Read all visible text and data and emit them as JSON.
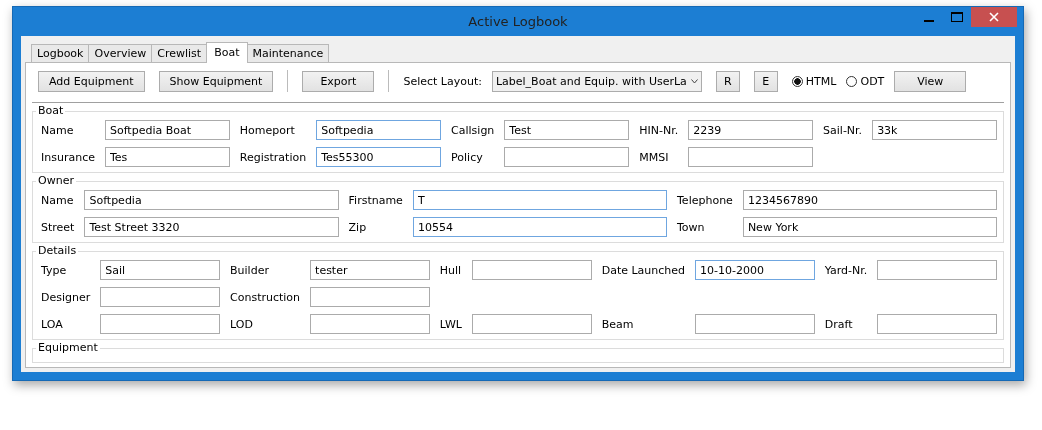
{
  "window": {
    "title": "Active Logbook"
  },
  "tabs": [
    {
      "label": "Logbook",
      "selected": false
    },
    {
      "label": "Overview",
      "selected": false
    },
    {
      "label": "Crewlist",
      "selected": false
    },
    {
      "label": "Boat",
      "selected": true
    },
    {
      "label": "Maintenance",
      "selected": false
    }
  ],
  "toolbar": [
    {
      "kind": "button",
      "label": "Add Equipment"
    },
    {
      "kind": "button",
      "label": "Show Equipment"
    },
    {
      "kind": "separator"
    },
    {
      "kind": "button",
      "label": "Export"
    },
    {
      "kind": "separator"
    },
    {
      "kind": "label",
      "label": "Select Layout:"
    },
    {
      "kind": "dropdown",
      "value": "Label_Boat and Equip. with UserLa"
    },
    {
      "kind": "small-button",
      "label": "R"
    },
    {
      "kind": "small-button",
      "label": "E"
    },
    {
      "kind": "radio",
      "label": "HTML",
      "selected": true
    },
    {
      "kind": "radio",
      "label": "ODT",
      "selected": false
    },
    {
      "kind": "button",
      "label": "View"
    }
  ],
  "sections": [
    {
      "title": "Boat",
      "rows": [
        [
          {
            "label": "Name",
            "value": "Softpedia Boat",
            "focused": false
          },
          {
            "label": "Homeport",
            "value": "Softpedia",
            "focused": true
          },
          {
            "label": "Callsign",
            "value": "Test",
            "focused": false
          },
          {
            "label": "HIN-Nr.",
            "value": "2239",
            "focused": false
          },
          {
            "label": "Sail-Nr.",
            "value": "33k",
            "focused": false
          }
        ],
        [
          {
            "label": "Insurance",
            "value": "Tes",
            "focused": false
          },
          {
            "label": "Registration",
            "value": "Tes55300",
            "focused": true
          },
          {
            "label": "Policy",
            "focused": false
          },
          {
            "label": "MMSI",
            "focused": false
          }
        ]
      ]
    },
    {
      "title": "Owner",
      "rows": [
        [
          {
            "label": "Name",
            "value": "Softpedia",
            "focused": false
          },
          {
            "label": "Firstname",
            "value": "T",
            "focused": true
          },
          {
            "label": "Telephone",
            "value": "1234567890",
            "focused": false
          }
        ],
        [
          {
            "label": "Street",
            "value": "Test Street 3320",
            "focused": false
          },
          {
            "label": "Zip",
            "value": "10554",
            "focused": true
          },
          {
            "label": "Town",
            "value": "New York",
            "focused": false
          }
        ]
      ]
    },
    {
      "title": "Details",
      "rows": [
        [
          {
            "label": "Type",
            "value": "Sail",
            "focused": false
          },
          {
            "label": "Builder",
            "value": "tester",
            "focused": false
          },
          {
            "label": "Hull",
            "focused": false
          },
          {
            "label": "Date Launched",
            "value": "10-10-2000",
            "focused": true
          },
          {
            "label": "Yard-Nr.",
            "focused": false
          }
        ],
        [
          {
            "label": "Designer",
            "focused": false
          },
          {
            "label": "Construction",
            "focused": false
          }
        ],
        [
          {
            "label": "LOA",
            "focused": false
          },
          {
            "label": "LOD",
            "focused": false
          },
          {
            "label": "LWL",
            "focused": false
          },
          {
            "label": "Beam",
            "focused": false
          },
          {
            "label": "Draft",
            "focused": false
          }
        ]
      ]
    },
    {
      "title": "Equipment"
    }
  ]
}
